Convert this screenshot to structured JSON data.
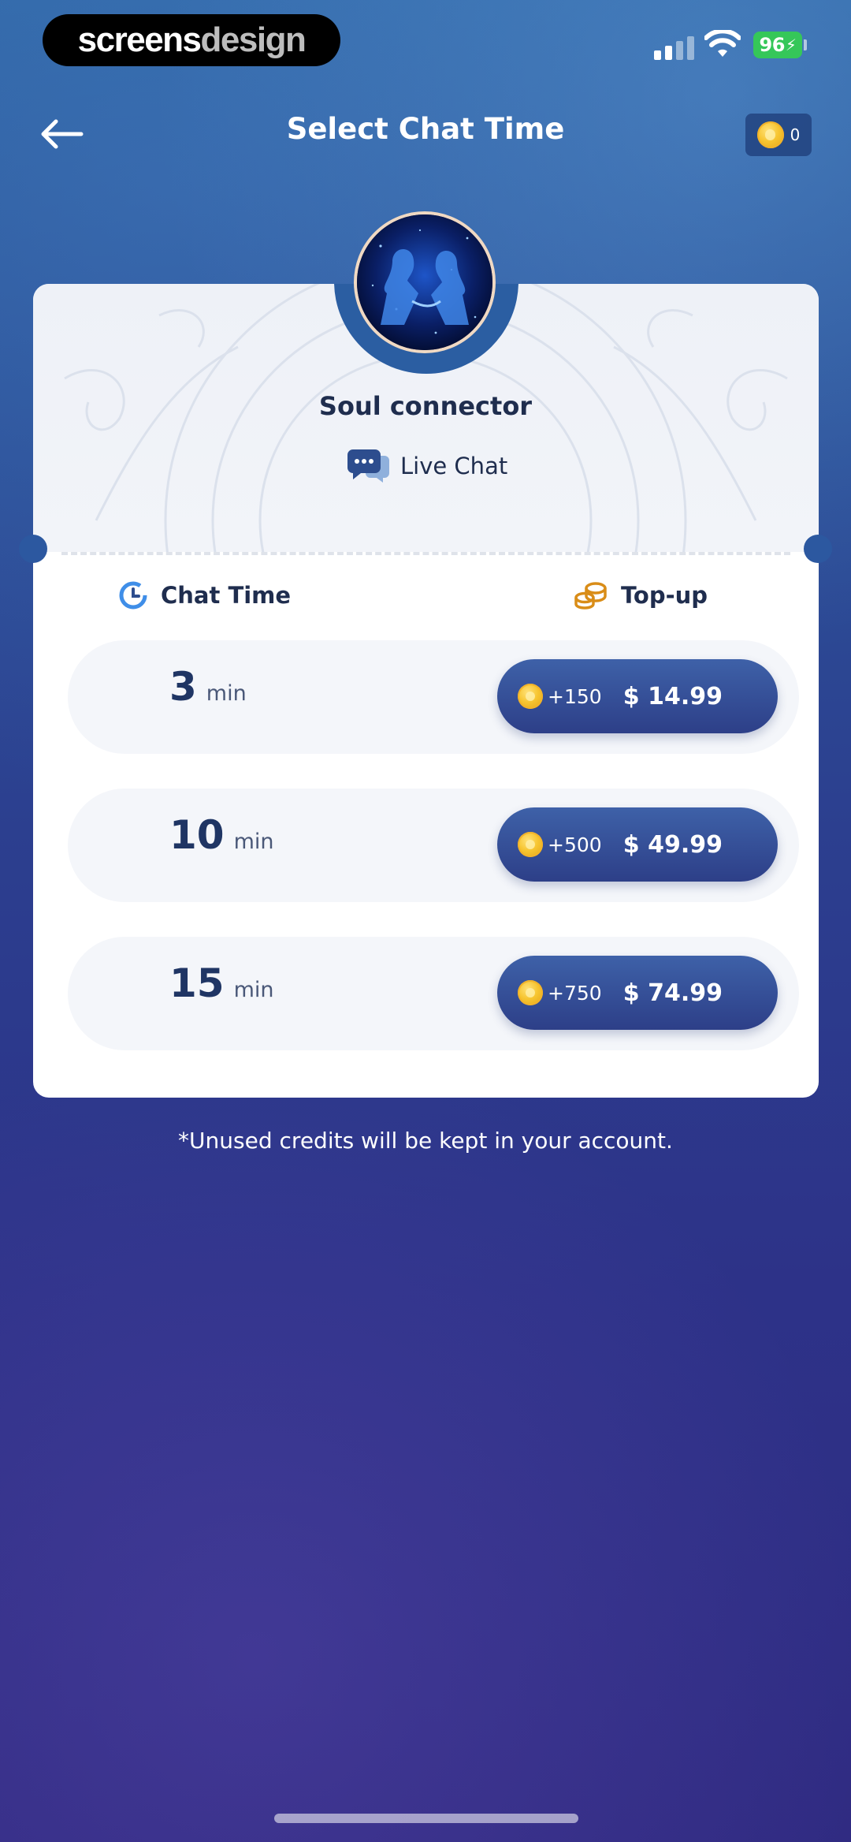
{
  "watermark": {
    "part1": "screens",
    "part2": "design"
  },
  "status_bar": {
    "battery": "96"
  },
  "header": {
    "title": "Select Chat Time",
    "coin_balance": "0"
  },
  "advisor": {
    "name": "Soul connector",
    "chat_type": "Live Chat"
  },
  "columns": {
    "chat_time": "Chat Time",
    "top_up": "Top-up"
  },
  "options": [
    {
      "minutes": "3",
      "unit": "min",
      "credits": "+150",
      "price": "$ 14.99"
    },
    {
      "minutes": "10",
      "unit": "min",
      "credits": "+500",
      "price": "$ 49.99"
    },
    {
      "minutes": "15",
      "unit": "min",
      "credits": "+750",
      "price": "$ 74.99"
    }
  ],
  "footnote": "*Unused credits will be kept in your account.",
  "colors": {
    "background": "#2c4b94",
    "card": "#ffffff",
    "button": "#34509a",
    "coin": "#f7c531",
    "text_dark": "#1f2d4e"
  }
}
